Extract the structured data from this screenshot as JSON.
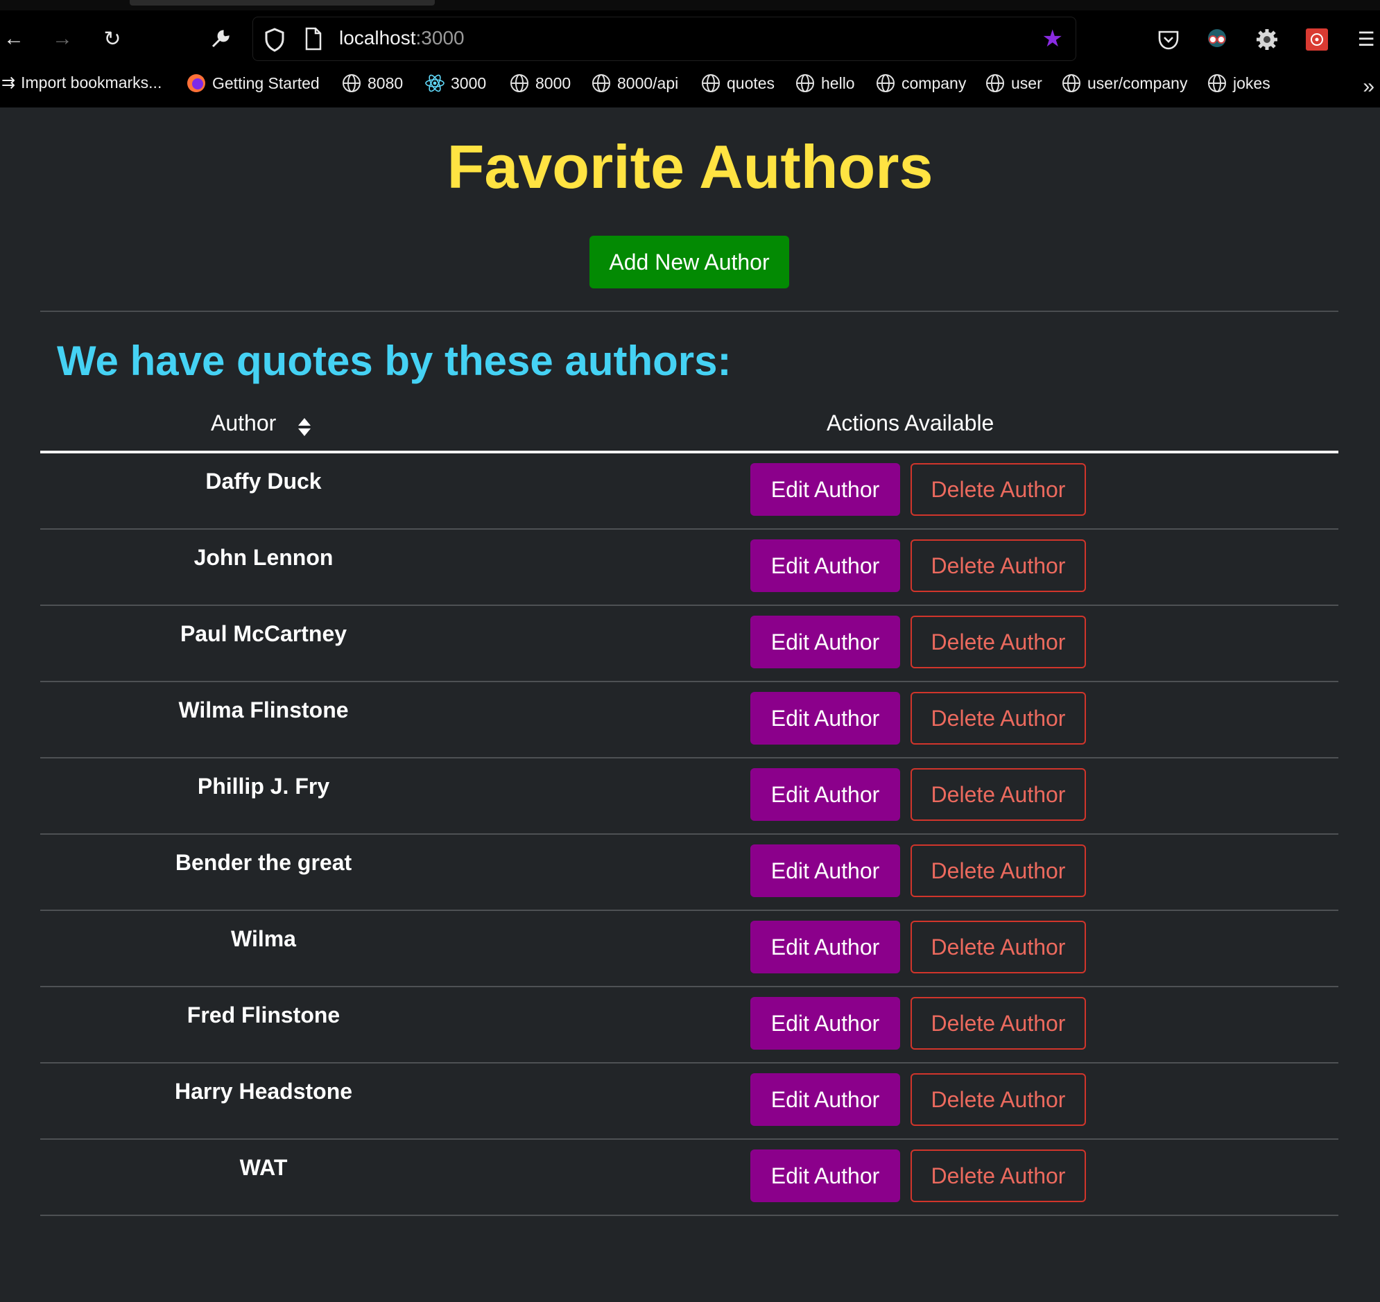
{
  "browser": {
    "url_host": "localhost",
    "url_port": ":3000",
    "bookmarks": [
      {
        "label": "Import bookmarks...",
        "icon": "import-icon"
      },
      {
        "label": "Getting Started",
        "icon": "firefox-icon"
      },
      {
        "label": "8080",
        "icon": "globe-icon"
      },
      {
        "label": "3000",
        "icon": "react-icon"
      },
      {
        "label": "8000",
        "icon": "globe-icon"
      },
      {
        "label": "8000/api",
        "icon": "globe-icon"
      },
      {
        "label": "quotes",
        "icon": "globe-icon"
      },
      {
        "label": "hello",
        "icon": "globe-icon"
      },
      {
        "label": "company",
        "icon": "globe-icon"
      },
      {
        "label": "user",
        "icon": "globe-icon"
      },
      {
        "label": "user/company",
        "icon": "globe-icon"
      },
      {
        "label": "jokes",
        "icon": "globe-icon"
      }
    ]
  },
  "page": {
    "title": "Favorite Authors",
    "add_button": "Add New Author",
    "subtitle": "We have quotes by these authors:"
  },
  "table": {
    "headers": {
      "author": "Author",
      "actions": "Actions Available"
    },
    "edit_label": "Edit Author",
    "delete_label": "Delete Author",
    "rows": [
      "Daffy Duck",
      "John Lennon",
      "Paul McCartney",
      "Wilma Flinstone",
      "Phillip J. Fry",
      "Bender the great",
      "Wilma",
      "Fred Flinstone",
      "Harry Headstone",
      "WAT"
    ]
  },
  "colors": {
    "title": "#ffe342",
    "subtitle": "#45d2f4",
    "add_button": "#038a03",
    "edit_button": "#8b008b",
    "delete_button": "#d1352b",
    "background": "#222528"
  }
}
